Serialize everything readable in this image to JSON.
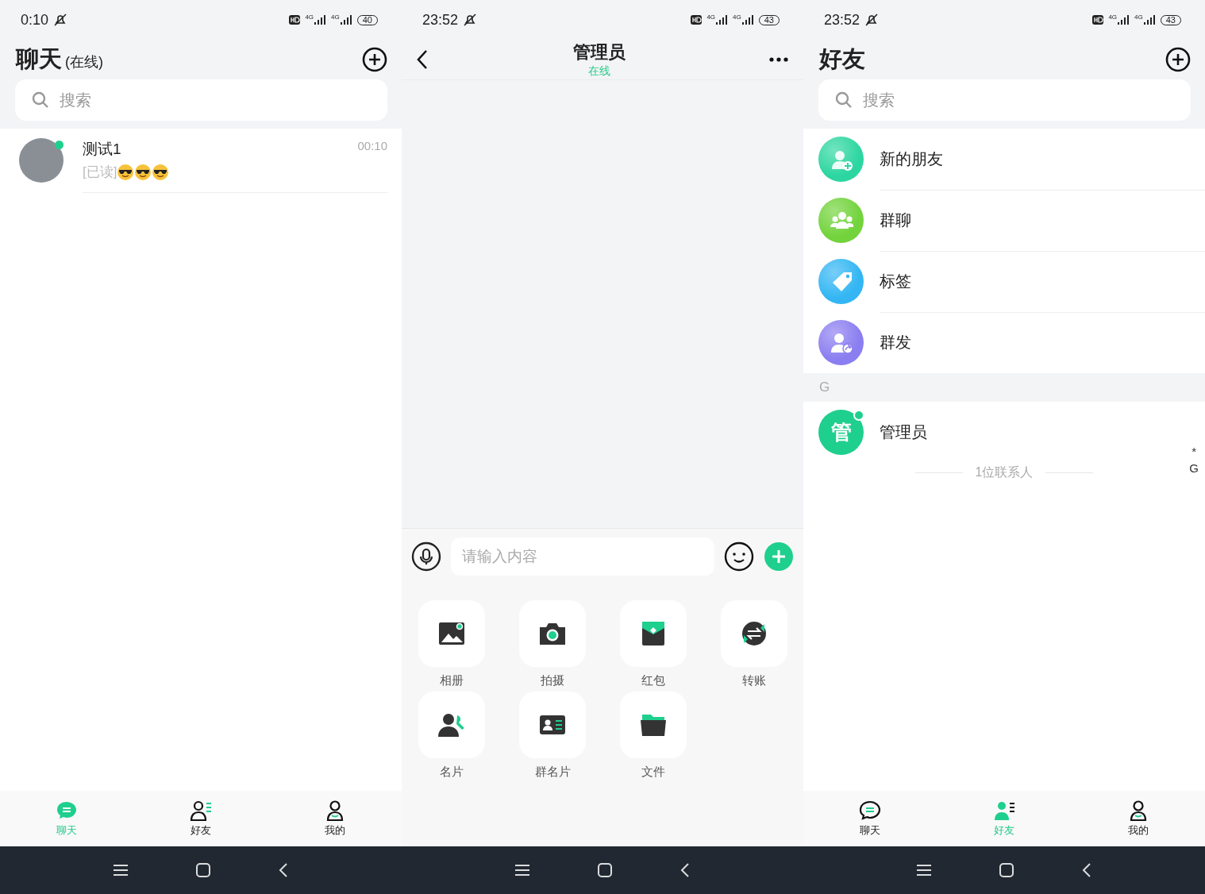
{
  "screens": [
    {
      "kind": "chat_list",
      "status_bar": {
        "time": "0:10",
        "network": [
          "4G",
          "4G"
        ],
        "battery": "40"
      },
      "title": "聊天",
      "subtitle": "(在线)",
      "search": {
        "placeholder": "搜索"
      },
      "conversations": [
        {
          "name": "测试1",
          "preview": "[已读]",
          "emoji_icons": [
            {
              "kind": "sunglasses"
            },
            {
              "kind": "sunglasses"
            },
            {
              "kind": "sunglasses"
            }
          ],
          "time": "00:10",
          "online": true
        }
      ],
      "tab_bar": [
        {
          "kind": "chat",
          "label": "聊天",
          "selected": true
        },
        {
          "kind": "friends",
          "label": "好友",
          "selected": false
        },
        {
          "kind": "me",
          "label": "我的",
          "selected": false
        }
      ]
    },
    {
      "kind": "chat",
      "status_bar": {
        "time": "23:52",
        "network": [
          "4G",
          "4G"
        ],
        "battery": "43"
      },
      "title": "管理员",
      "subtitle": "在线",
      "input": {
        "placeholder": "请输入内容"
      },
      "actions": [
        {
          "kind": "album",
          "label": "相册"
        },
        {
          "kind": "camera",
          "label": "拍摄"
        },
        {
          "kind": "red_packet",
          "label": "红包"
        },
        {
          "kind": "transfer",
          "label": "转账"
        },
        {
          "kind": "card",
          "label": "名片"
        },
        {
          "kind": "group_card",
          "label": "群名片"
        },
        {
          "kind": "file",
          "label": "文件"
        }
      ]
    },
    {
      "kind": "contacts",
      "status_bar": {
        "time": "23:52",
        "network": [
          "4G",
          "4G"
        ],
        "battery": "43"
      },
      "title": "好友",
      "search": {
        "placeholder": "搜索"
      },
      "entries": [
        {
          "kind": "new_friend",
          "label": "新的朋友",
          "color": "#2dd6a0"
        },
        {
          "kind": "group_chat",
          "label": "群聊",
          "color": "#72d33c"
        },
        {
          "kind": "tag",
          "label": "标签",
          "color": "#33b6f3"
        },
        {
          "kind": "broadcast",
          "label": "群发",
          "color": "#8b7ef0"
        }
      ],
      "sections": [
        {
          "letter": "G",
          "contacts": [
            {
              "name": "管理员",
              "avatar_text": "管",
              "online": true
            }
          ]
        }
      ],
      "footer": "1位联系人",
      "index": [
        "*",
        "G"
      ],
      "tab_bar": [
        {
          "kind": "chat",
          "label": "聊天",
          "selected": false
        },
        {
          "kind": "friends",
          "label": "好友",
          "selected": true
        },
        {
          "kind": "me",
          "label": "我的",
          "selected": false
        }
      ]
    }
  ]
}
